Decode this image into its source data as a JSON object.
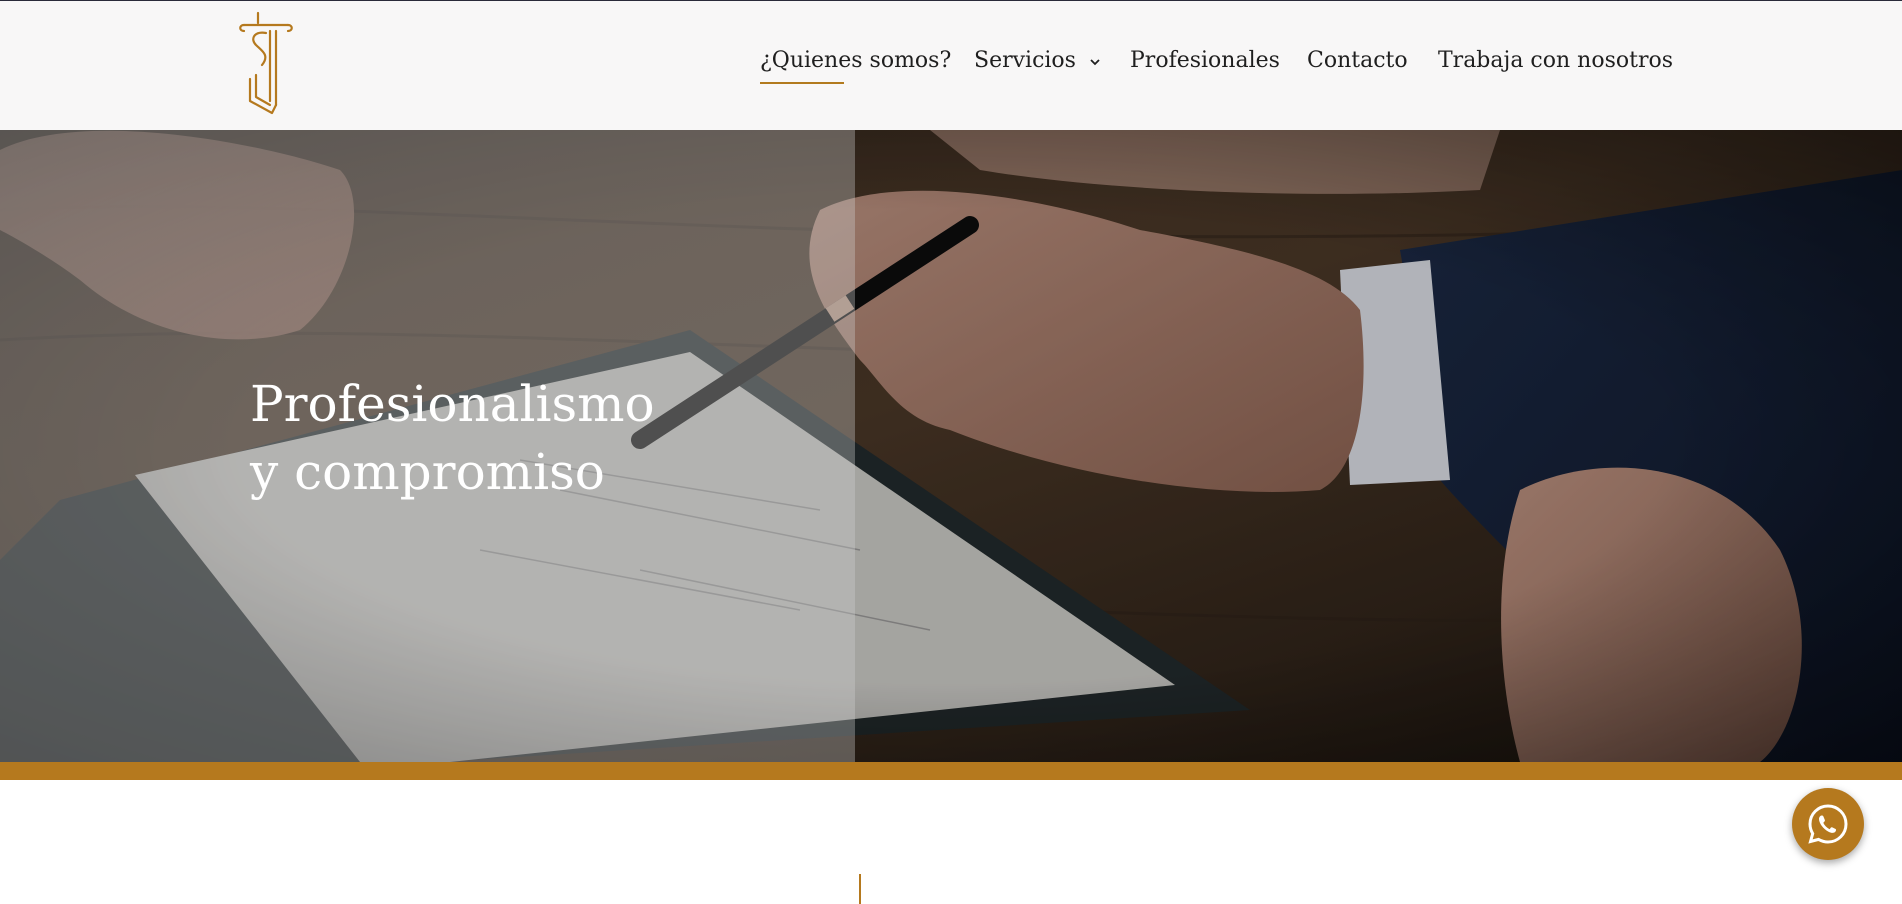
{
  "header": {
    "nav": [
      {
        "label": "¿Quienes somos?",
        "active": true
      },
      {
        "label": "Servicios",
        "has_dropdown": true
      },
      {
        "label": "Profesionales"
      },
      {
        "label": "Contacto"
      },
      {
        "label": "Trabaja con nosotros"
      }
    ]
  },
  "hero": {
    "title_line1": "Profesionalismo",
    "title_line2": "y compromiso"
  },
  "colors": {
    "accent": "#b5791e",
    "header_bg": "#f8f7f7",
    "text": "#1f1f1f"
  },
  "icons": {
    "logo": "pillar-monogram-logo",
    "dropdown": "chevron-down-icon",
    "chat": "whatsapp-icon"
  }
}
